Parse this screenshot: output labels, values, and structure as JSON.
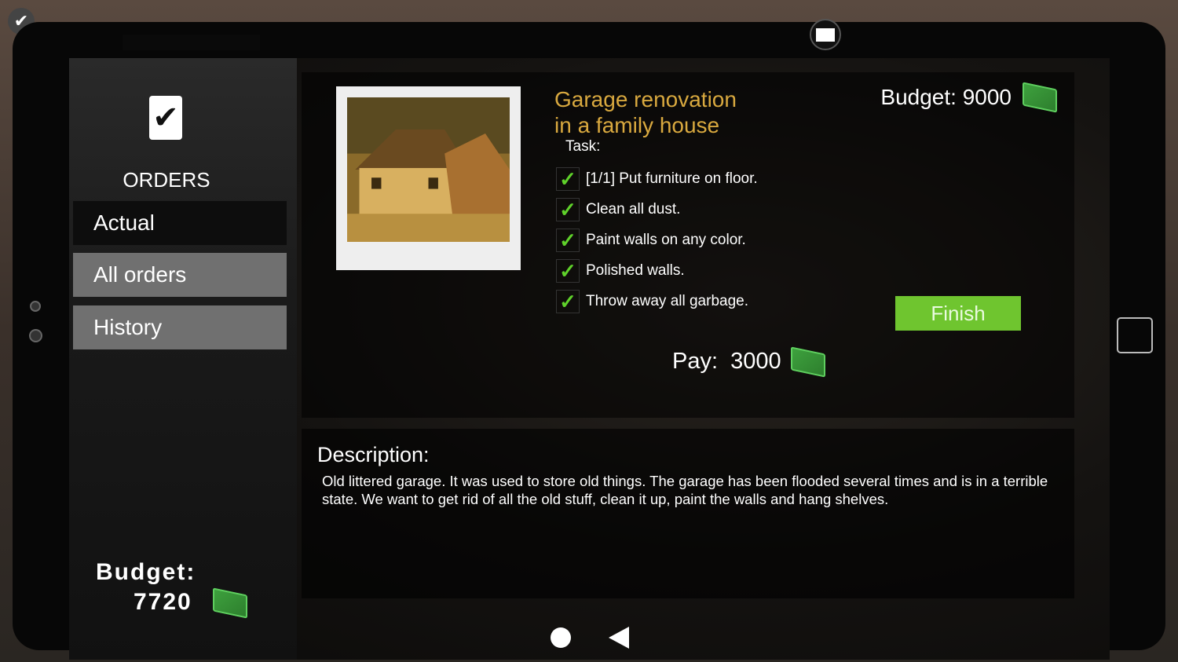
{
  "sidebar": {
    "title": "ORDERS",
    "items": [
      {
        "label": "Actual",
        "active": true
      },
      {
        "label": "All orders",
        "active": false
      },
      {
        "label": "History",
        "active": false
      }
    ],
    "budget_label": "Budget:",
    "budget_value": "7720"
  },
  "order": {
    "title_line1": "Garage renovation",
    "title_line2": "in a family house",
    "task_label": "Task:",
    "tasks": [
      {
        "text": "[1/1] Put furniture on floor.",
        "done": true
      },
      {
        "text": "Clean all dust.",
        "done": true
      },
      {
        "text": "Paint walls on any color.",
        "done": true
      },
      {
        "text": "Polished walls.",
        "done": true
      },
      {
        "text": "Throw away all garbage.",
        "done": true
      }
    ],
    "budget": "Budget: 9000",
    "pay": "Pay:  3000",
    "finish_label": "Finish"
  },
  "description": {
    "heading": "Description:",
    "text": "Old littered garage. It was used to store old things. The garage has been flooded several times and is in a terrible state. We want to get rid of all the old stuff, clean it up, paint the walls and hang shelves."
  },
  "colors": {
    "title": "#d9a93f",
    "finish": "#6fc52f",
    "check": "#5fd12a"
  },
  "icons": {
    "orders": "checkbox-icon",
    "money": "cash-icon",
    "mail": "envelope-icon",
    "home": "circle-icon",
    "back": "triangle-back-icon"
  }
}
